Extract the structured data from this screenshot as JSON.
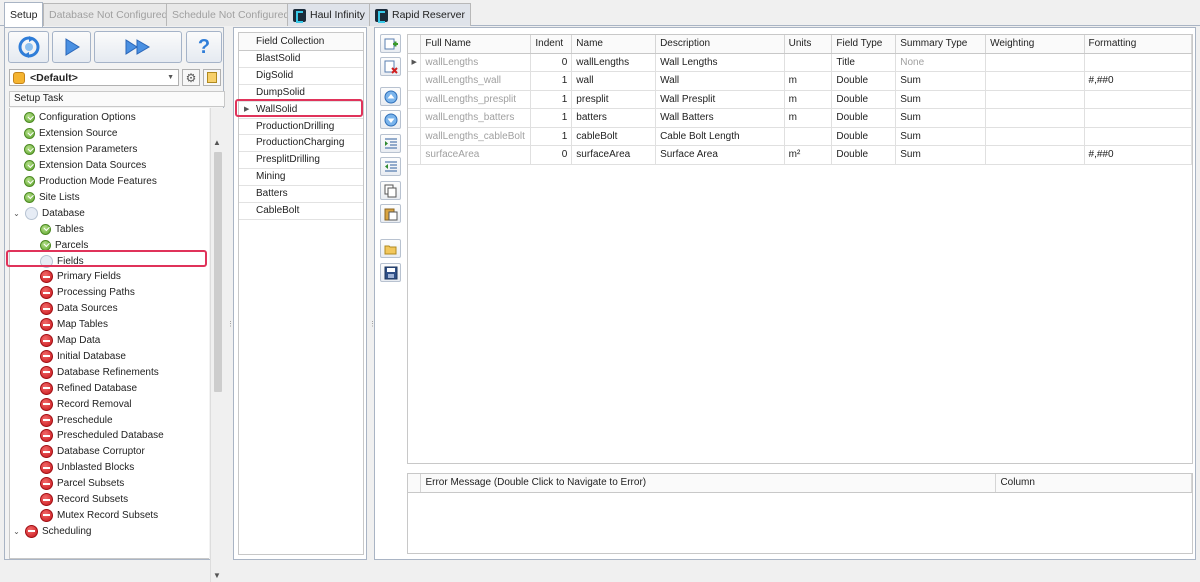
{
  "tabs": [
    {
      "label": "Setup",
      "state": "active"
    },
    {
      "label": "Database Not Configured",
      "state": "disabled"
    },
    {
      "label": "Schedule Not Configured",
      "state": "disabled"
    },
    {
      "label": "Haul Infinity",
      "state": "app"
    },
    {
      "label": "Rapid Reserver",
      "state": "app"
    }
  ],
  "left": {
    "buttons": [
      "refresh-icon",
      "play-icon",
      "fast-forward-icon",
      "help-icon"
    ],
    "help_label": "?",
    "profile": "<Default>",
    "task_header": "Setup Task",
    "tree": [
      {
        "label": "Configuration Options",
        "status": "ok",
        "level": 1
      },
      {
        "label": "Extension Source",
        "status": "ok",
        "level": 1
      },
      {
        "label": "Extension Parameters",
        "status": "ok",
        "level": 1
      },
      {
        "label": "Extension Data Sources",
        "status": "ok",
        "level": 1
      },
      {
        "label": "Production Mode Features",
        "status": "ok",
        "level": 1
      },
      {
        "label": "Site Lists",
        "status": "ok",
        "level": 1
      },
      {
        "label": "Database",
        "status": "empty",
        "level": 0,
        "expanded": true
      },
      {
        "label": "Tables",
        "status": "ok",
        "level": 2
      },
      {
        "label": "Parcels",
        "status": "ok",
        "level": 2
      },
      {
        "label": "Fields",
        "status": "empty",
        "level": 2,
        "highlighted": true
      },
      {
        "label": "Primary Fields",
        "status": "stop",
        "level": 2
      },
      {
        "label": "Processing Paths",
        "status": "stop",
        "level": 2
      },
      {
        "label": "Data Sources",
        "status": "stop",
        "level": 2
      },
      {
        "label": "Map Tables",
        "status": "stop",
        "level": 2
      },
      {
        "label": "Map Data",
        "status": "stop",
        "level": 2
      },
      {
        "label": "Initial Database",
        "status": "stop",
        "level": 2
      },
      {
        "label": "Database Refinements",
        "status": "stop",
        "level": 2
      },
      {
        "label": "Refined Database",
        "status": "stop",
        "level": 2
      },
      {
        "label": "Record Removal",
        "status": "stop",
        "level": 2
      },
      {
        "label": "Preschedule",
        "status": "stop",
        "level": 2
      },
      {
        "label": "Prescheduled Database",
        "status": "stop",
        "level": 2
      },
      {
        "label": "Database Corruptor",
        "status": "stop",
        "level": 2
      },
      {
        "label": "Unblasted Blocks",
        "status": "stop",
        "level": 2
      },
      {
        "label": "Parcel Subsets",
        "status": "stop",
        "level": 2
      },
      {
        "label": "Record Subsets",
        "status": "stop",
        "level": 2
      },
      {
        "label": "Mutex Record Subsets",
        "status": "stop",
        "level": 2
      },
      {
        "label": "Scheduling",
        "status": "stop",
        "level": 0,
        "expanded": true
      }
    ]
  },
  "field_collection": {
    "header": "Field Collection",
    "items": [
      "BlastSolid",
      "DigSolid",
      "DumpSolid",
      "WallSolid",
      "ProductionDrilling",
      "ProductionCharging",
      "PresplitDrilling",
      "Mining",
      "Batters",
      "CableBolt"
    ],
    "selected": "WallSolid"
  },
  "toolbar": [
    "add-field-icon",
    "delete-field-icon",
    "move-up-icon",
    "move-down-icon",
    "indent-icon",
    "outdent-icon",
    "copy-icon",
    "paste-icon",
    "open-icon",
    "save-icon"
  ],
  "grid": {
    "columns": [
      "Full Name",
      "Indent",
      "Name",
      "Description",
      "Units",
      "Field Type",
      "Summary Type",
      "Weighting",
      "Formatting"
    ],
    "rows": [
      {
        "full_name": "wallLengths",
        "indent": "0",
        "name": "wallLengths",
        "description": "Wall Lengths",
        "units": "",
        "field_type": "Title",
        "summary_type": "None",
        "weighting": "",
        "formatting": "",
        "current": true
      },
      {
        "full_name": "wallLengths_wall",
        "indent": "1",
        "name": "wall",
        "description": "Wall",
        "units": "m",
        "field_type": "Double",
        "summary_type": "Sum",
        "weighting": "",
        "formatting": "#,##0"
      },
      {
        "full_name": "wallLengths_presplit",
        "indent": "1",
        "name": "presplit",
        "description": "Wall Presplit",
        "units": "m",
        "field_type": "Double",
        "summary_type": "Sum",
        "weighting": "",
        "formatting": ""
      },
      {
        "full_name": "wallLengths_batters",
        "indent": "1",
        "name": "batters",
        "description": "Wall Batters",
        "units": "m",
        "field_type": "Double",
        "summary_type": "Sum",
        "weighting": "",
        "formatting": ""
      },
      {
        "full_name": "wallLengths_cableBolt",
        "indent": "1",
        "name": "cableBolt",
        "description": "Cable Bolt Length",
        "units": "",
        "field_type": "Double",
        "summary_type": "Sum",
        "weighting": "",
        "formatting": ""
      },
      {
        "full_name": "surfaceArea",
        "indent": "0",
        "name": "surfaceArea",
        "description": "Surface Area",
        "units": "m²",
        "field_type": "Double",
        "summary_type": "Sum",
        "weighting": "",
        "formatting": "#,##0"
      }
    ]
  },
  "errors": {
    "columns": [
      "Error Message (Double Click to Navigate to Error)",
      "Column"
    ],
    "rows": []
  },
  "colors": {
    "highlight": "#e0335a",
    "ok": "#5ca42b",
    "stop": "#c8141a"
  }
}
